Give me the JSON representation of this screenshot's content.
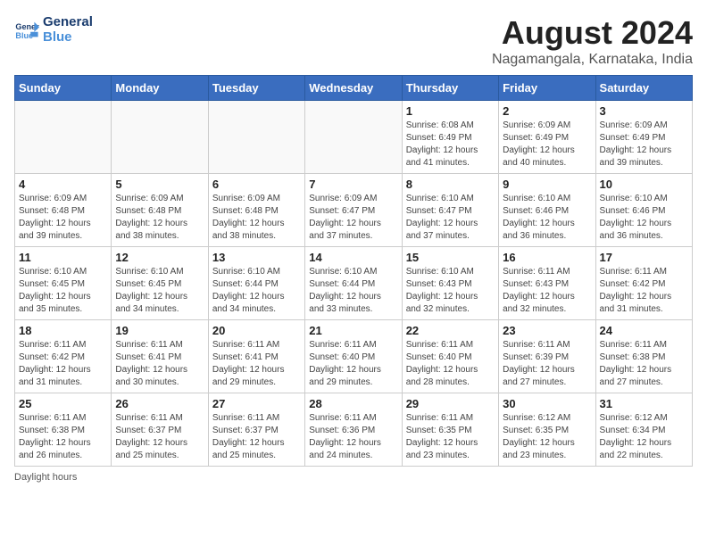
{
  "logo": {
    "line1": "General",
    "line2": "Blue"
  },
  "title": "August 2024",
  "subtitle": "Nagamangala, Karnataka, India",
  "days_of_week": [
    "Sunday",
    "Monday",
    "Tuesday",
    "Wednesday",
    "Thursday",
    "Friday",
    "Saturday"
  ],
  "weeks": [
    [
      {
        "day": "",
        "info": ""
      },
      {
        "day": "",
        "info": ""
      },
      {
        "day": "",
        "info": ""
      },
      {
        "day": "",
        "info": ""
      },
      {
        "day": "1",
        "info": "Sunrise: 6:08 AM\nSunset: 6:49 PM\nDaylight: 12 hours and 41 minutes."
      },
      {
        "day": "2",
        "info": "Sunrise: 6:09 AM\nSunset: 6:49 PM\nDaylight: 12 hours and 40 minutes."
      },
      {
        "day": "3",
        "info": "Sunrise: 6:09 AM\nSunset: 6:49 PM\nDaylight: 12 hours and 39 minutes."
      }
    ],
    [
      {
        "day": "4",
        "info": "Sunrise: 6:09 AM\nSunset: 6:48 PM\nDaylight: 12 hours and 39 minutes."
      },
      {
        "day": "5",
        "info": "Sunrise: 6:09 AM\nSunset: 6:48 PM\nDaylight: 12 hours and 38 minutes."
      },
      {
        "day": "6",
        "info": "Sunrise: 6:09 AM\nSunset: 6:48 PM\nDaylight: 12 hours and 38 minutes."
      },
      {
        "day": "7",
        "info": "Sunrise: 6:09 AM\nSunset: 6:47 PM\nDaylight: 12 hours and 37 minutes."
      },
      {
        "day": "8",
        "info": "Sunrise: 6:10 AM\nSunset: 6:47 PM\nDaylight: 12 hours and 37 minutes."
      },
      {
        "day": "9",
        "info": "Sunrise: 6:10 AM\nSunset: 6:46 PM\nDaylight: 12 hours and 36 minutes."
      },
      {
        "day": "10",
        "info": "Sunrise: 6:10 AM\nSunset: 6:46 PM\nDaylight: 12 hours and 36 minutes."
      }
    ],
    [
      {
        "day": "11",
        "info": "Sunrise: 6:10 AM\nSunset: 6:45 PM\nDaylight: 12 hours and 35 minutes."
      },
      {
        "day": "12",
        "info": "Sunrise: 6:10 AM\nSunset: 6:45 PM\nDaylight: 12 hours and 34 minutes."
      },
      {
        "day": "13",
        "info": "Sunrise: 6:10 AM\nSunset: 6:44 PM\nDaylight: 12 hours and 34 minutes."
      },
      {
        "day": "14",
        "info": "Sunrise: 6:10 AM\nSunset: 6:44 PM\nDaylight: 12 hours and 33 minutes."
      },
      {
        "day": "15",
        "info": "Sunrise: 6:10 AM\nSunset: 6:43 PM\nDaylight: 12 hours and 32 minutes."
      },
      {
        "day": "16",
        "info": "Sunrise: 6:11 AM\nSunset: 6:43 PM\nDaylight: 12 hours and 32 minutes."
      },
      {
        "day": "17",
        "info": "Sunrise: 6:11 AM\nSunset: 6:42 PM\nDaylight: 12 hours and 31 minutes."
      }
    ],
    [
      {
        "day": "18",
        "info": "Sunrise: 6:11 AM\nSunset: 6:42 PM\nDaylight: 12 hours and 31 minutes."
      },
      {
        "day": "19",
        "info": "Sunrise: 6:11 AM\nSunset: 6:41 PM\nDaylight: 12 hours and 30 minutes."
      },
      {
        "day": "20",
        "info": "Sunrise: 6:11 AM\nSunset: 6:41 PM\nDaylight: 12 hours and 29 minutes."
      },
      {
        "day": "21",
        "info": "Sunrise: 6:11 AM\nSunset: 6:40 PM\nDaylight: 12 hours and 29 minutes."
      },
      {
        "day": "22",
        "info": "Sunrise: 6:11 AM\nSunset: 6:40 PM\nDaylight: 12 hours and 28 minutes."
      },
      {
        "day": "23",
        "info": "Sunrise: 6:11 AM\nSunset: 6:39 PM\nDaylight: 12 hours and 27 minutes."
      },
      {
        "day": "24",
        "info": "Sunrise: 6:11 AM\nSunset: 6:38 PM\nDaylight: 12 hours and 27 minutes."
      }
    ],
    [
      {
        "day": "25",
        "info": "Sunrise: 6:11 AM\nSunset: 6:38 PM\nDaylight: 12 hours and 26 minutes."
      },
      {
        "day": "26",
        "info": "Sunrise: 6:11 AM\nSunset: 6:37 PM\nDaylight: 12 hours and 25 minutes."
      },
      {
        "day": "27",
        "info": "Sunrise: 6:11 AM\nSunset: 6:37 PM\nDaylight: 12 hours and 25 minutes."
      },
      {
        "day": "28",
        "info": "Sunrise: 6:11 AM\nSunset: 6:36 PM\nDaylight: 12 hours and 24 minutes."
      },
      {
        "day": "29",
        "info": "Sunrise: 6:11 AM\nSunset: 6:35 PM\nDaylight: 12 hours and 23 minutes."
      },
      {
        "day": "30",
        "info": "Sunrise: 6:12 AM\nSunset: 6:35 PM\nDaylight: 12 hours and 23 minutes."
      },
      {
        "day": "31",
        "info": "Sunrise: 6:12 AM\nSunset: 6:34 PM\nDaylight: 12 hours and 22 minutes."
      }
    ]
  ],
  "footer": "Daylight hours"
}
